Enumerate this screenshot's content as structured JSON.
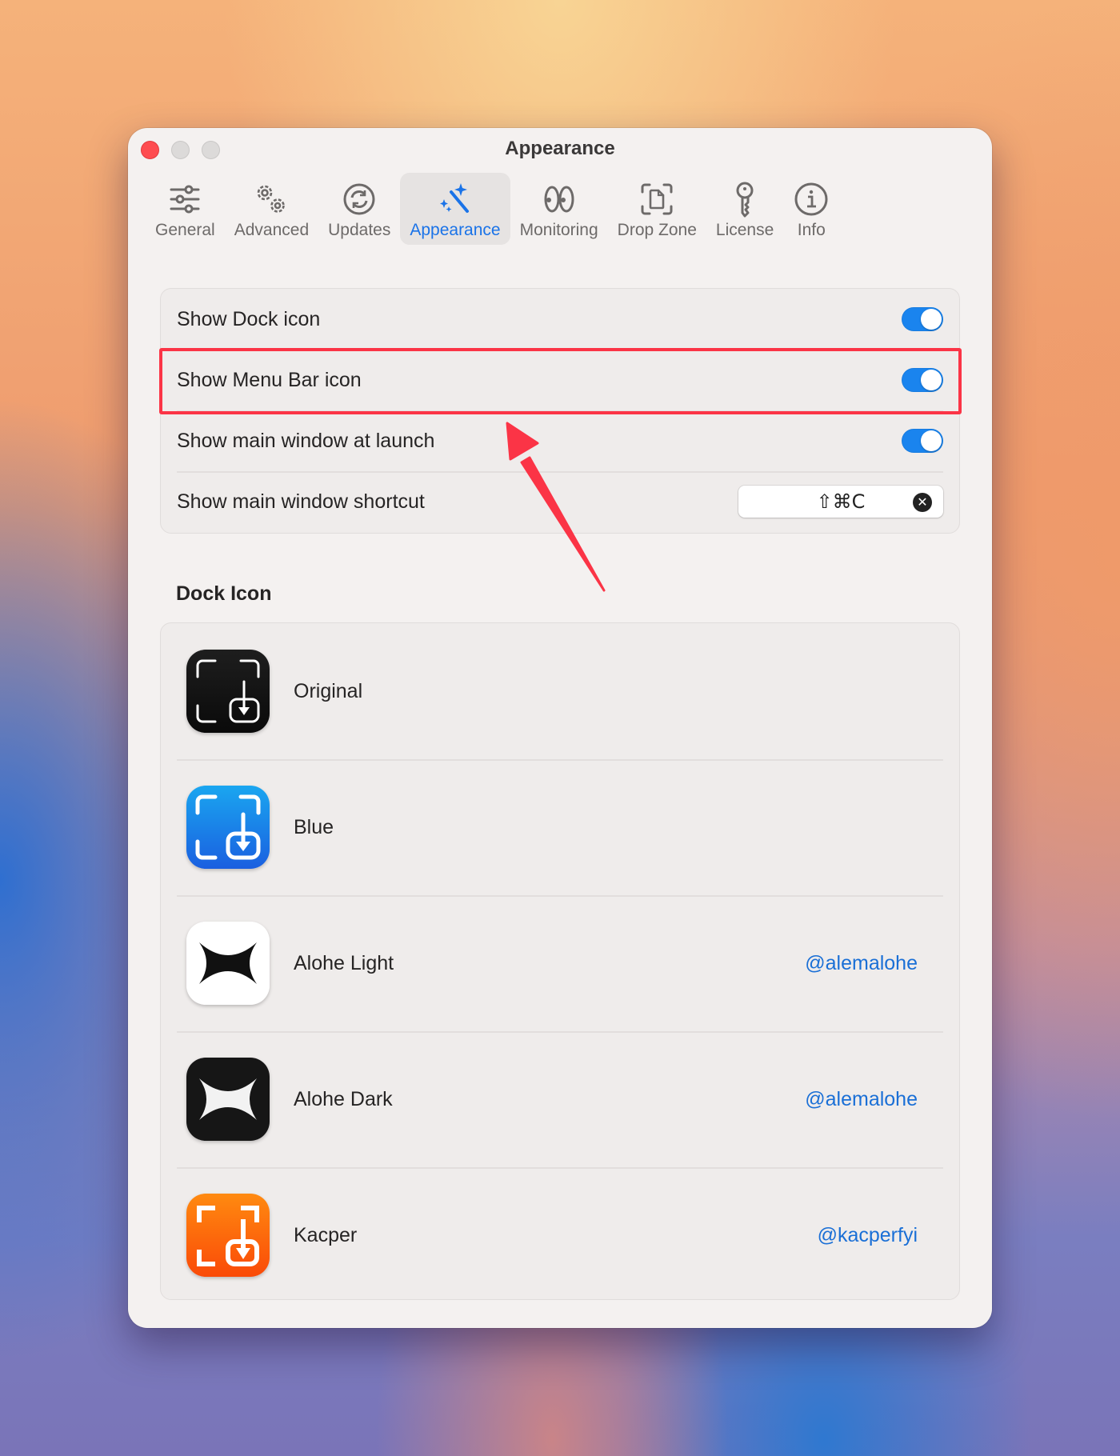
{
  "window": {
    "title": "Appearance",
    "traffic_lights": [
      "close",
      "minimize",
      "zoom"
    ]
  },
  "toolbar": {
    "active": "Appearance",
    "tabs": [
      {
        "label": "General",
        "icon": "sliders-icon"
      },
      {
        "label": "Advanced",
        "icon": "gears-icon"
      },
      {
        "label": "Updates",
        "icon": "refresh-icon"
      },
      {
        "label": "Appearance",
        "icon": "magic-wand-icon"
      },
      {
        "label": "Monitoring",
        "icon": "eyes-icon"
      },
      {
        "label": "Drop Zone",
        "icon": "doc-viewfinder-icon"
      },
      {
        "label": "License",
        "icon": "key-icon"
      },
      {
        "label": "Info",
        "icon": "info-icon"
      }
    ]
  },
  "settings": [
    {
      "label": "Show Dock icon",
      "type": "toggle",
      "value": true
    },
    {
      "label": "Show Menu Bar icon",
      "type": "toggle",
      "value": true,
      "highlighted": true
    },
    {
      "label": "Show main window at launch",
      "type": "toggle",
      "value": true
    },
    {
      "label": "Show main window shortcut",
      "type": "shortcut",
      "value": "⇧⌘C"
    }
  ],
  "dock_icon": {
    "heading": "Dock Icon",
    "options": [
      {
        "name": "Original",
        "credit": "",
        "color": "#111111"
      },
      {
        "name": "Blue",
        "credit": "",
        "color": "#1a7ee8"
      },
      {
        "name": "Alohe Light",
        "credit": "@alemalohe",
        "color": "#ffffff"
      },
      {
        "name": "Alohe Dark",
        "credit": "@alemalohe",
        "color": "#161616"
      },
      {
        "name": "Kacper",
        "credit": "@kacperfyi",
        "color": "#fb6a0c"
      }
    ]
  },
  "colors": {
    "accent": "#1a73e8",
    "toggle_on": "#1a84ee",
    "annotation": "#fb3446",
    "link": "#1a6fd6"
  },
  "annotation": {
    "type": "highlight-box-with-arrow",
    "target": "Show Menu Bar icon"
  }
}
